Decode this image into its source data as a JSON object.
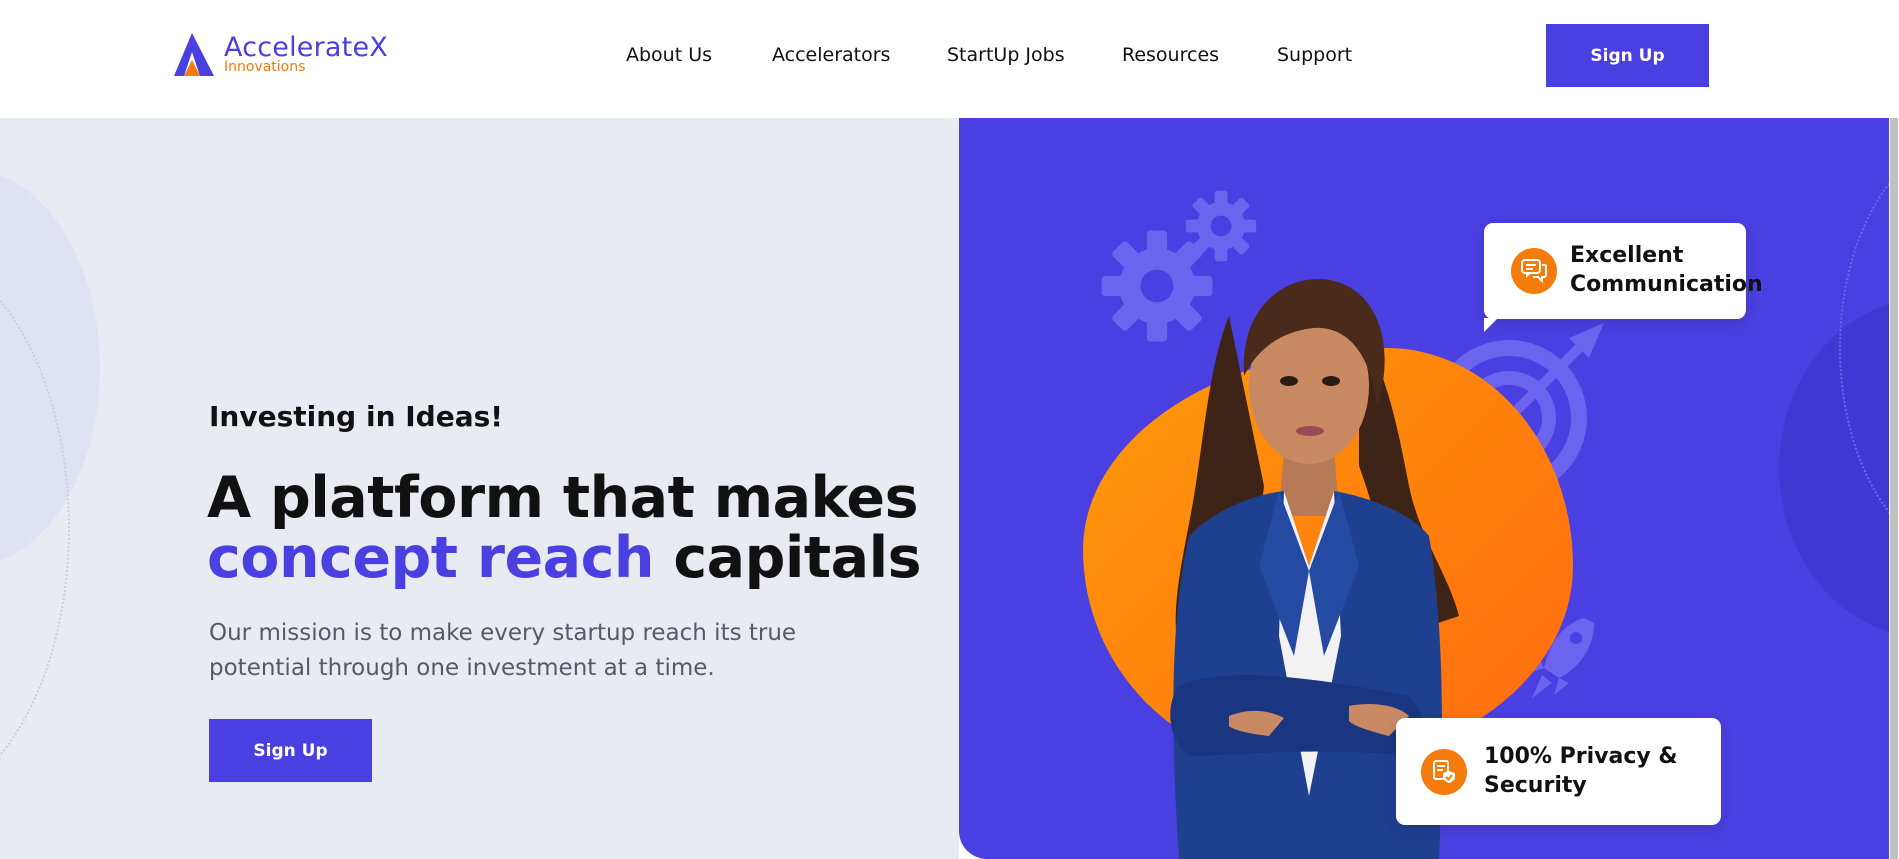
{
  "header": {
    "logo": {
      "name": "AccelerateX",
      "sub": "Innovations"
    },
    "nav": [
      {
        "label": "About Us"
      },
      {
        "label": "Accelerators"
      },
      {
        "label": "StartUp Jobs"
      },
      {
        "label": "Resources"
      },
      {
        "label": "Support"
      }
    ],
    "signup_label": "Sign Up"
  },
  "hero": {
    "tagline": "Investing in Ideas!",
    "headline_line1": "A platform that makes",
    "headline_accent": "concept reach",
    "headline_rest": "capitals",
    "mission": "Our mission is to make every startup reach its true potential through one investment at a time.",
    "signup_label": "Sign Up"
  },
  "features": {
    "communication": "Excellent Communication",
    "privacy": "100% Privacy & Security"
  },
  "icons": [
    "logo-icon",
    "gear-icon",
    "target-icon",
    "rocket-icon",
    "chat-icon",
    "security-icon"
  ],
  "colors": {
    "primary": "#4a3fe0",
    "accent": "#f47b0c",
    "hero_left_bg": "#e8ebf2"
  }
}
